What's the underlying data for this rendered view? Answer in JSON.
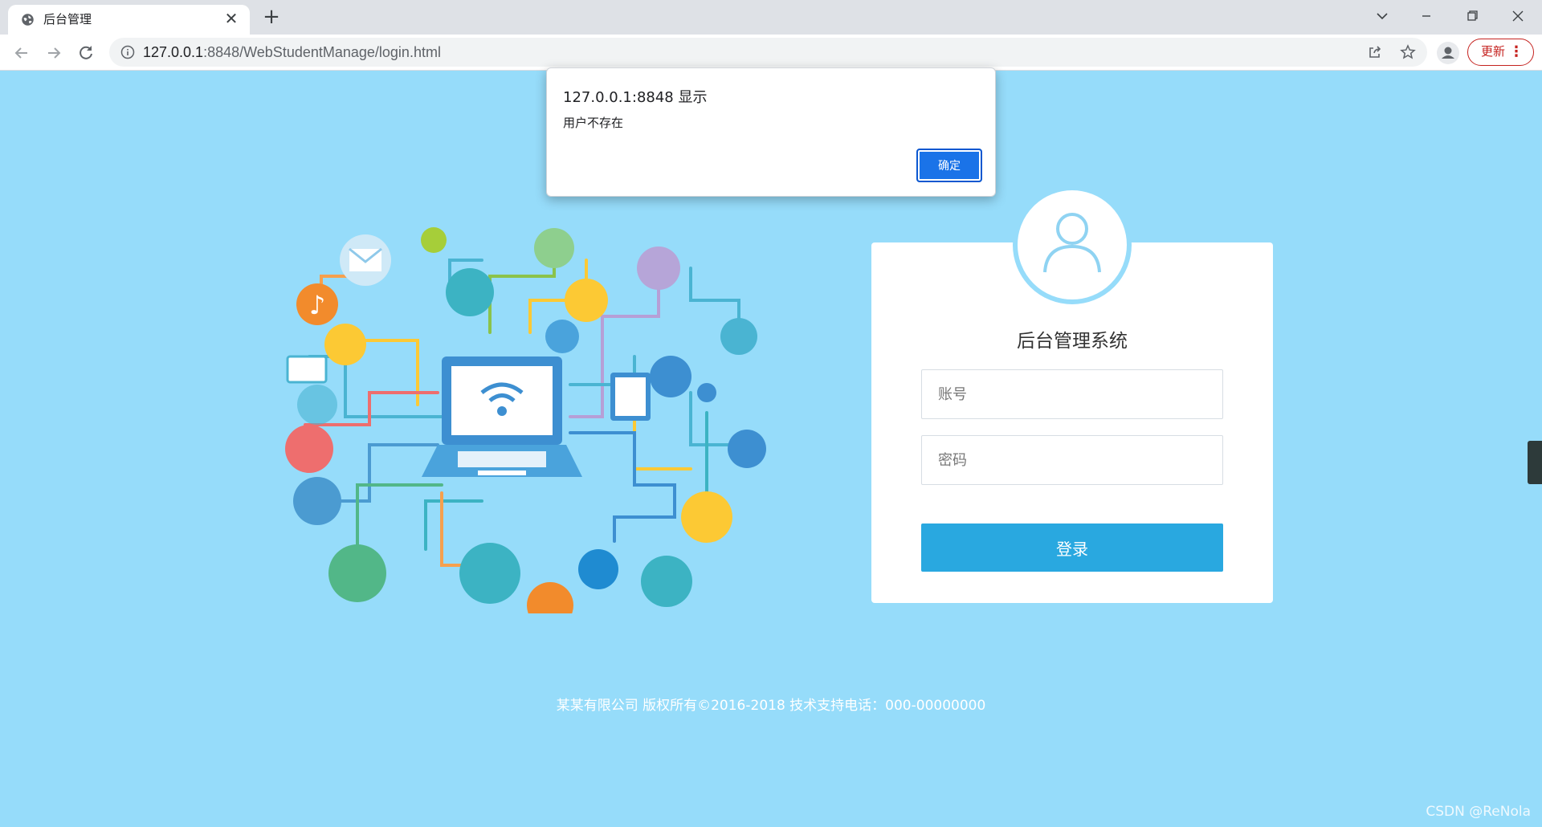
{
  "browser": {
    "tab_title": "后台管理",
    "tab_close": "✕",
    "new_tab": "+",
    "url_host": "127.0.0.1",
    "url_path": ":8848/WebStudentManage/login.html",
    "update_label": "更新",
    "update_menu": "⋮"
  },
  "dialog": {
    "title": "127.0.0.1:8848 显示",
    "message": "用户不存在",
    "ok_label": "确定"
  },
  "login": {
    "title": "后台管理系统",
    "account_placeholder": "账号",
    "password_placeholder": "密码",
    "submit_label": "登录"
  },
  "footer": {
    "text": "某某有限公司 版权所有©2016-2018 技术支持电话：000-00000000"
  },
  "watermark": "CSDN @ReNola",
  "colors": {
    "page_bg": "#96dcfa",
    "login_button": "#29a8e0",
    "dialog_button": "#1a73e8",
    "update_accent": "#c5221f"
  },
  "icons": [
    "globe-icon",
    "back-icon",
    "forward-icon",
    "reload-icon",
    "info-icon",
    "share-icon",
    "star-icon",
    "profile-icon",
    "user-icon"
  ]
}
